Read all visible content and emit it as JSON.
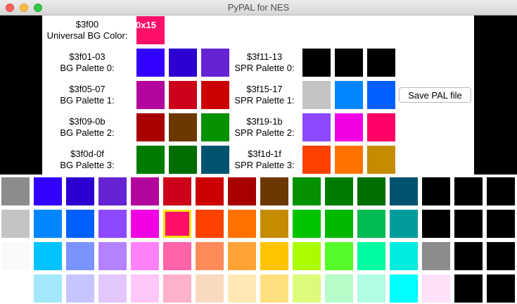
{
  "window": {
    "title": "PyPAL for NES"
  },
  "universal": {
    "address": "$3f00",
    "label": "Universal BG Color:",
    "hex": "0x15",
    "color": "#ff1068"
  },
  "bg_palettes": [
    {
      "address": "$3f01-03",
      "label": "BG Palette 0:",
      "colors": [
        "#3200ff",
        "#2b00d0",
        "#6523d3"
      ]
    },
    {
      "address": "$3f05-07",
      "label": "BG Palette 1:",
      "colors": [
        "#b3049e",
        "#cc0019",
        "#cb0000"
      ]
    },
    {
      "address": "$3f09-0b",
      "label": "BG Palette 2:",
      "colors": [
        "#a80000",
        "#6b3900",
        "#069100"
      ]
    },
    {
      "address": "$3f0d-0f",
      "label": "BG Palette 3:",
      "colors": [
        "#007d00",
        "#006d00",
        "#00536f"
      ]
    }
  ],
  "spr_palettes": [
    {
      "address": "$3f11-13",
      "label": "SPR Palette 0:",
      "colors": [
        "#000000",
        "#000000",
        "#000000"
      ]
    },
    {
      "address": "$3f15-17",
      "label": "SPR Palette 1:",
      "colors": [
        "#c4c4c4",
        "#0087ff",
        "#0060ff"
      ]
    },
    {
      "address": "$3f19-1b",
      "label": "SPR Palette 2:",
      "colors": [
        "#8c49ff",
        "#f100e4",
        "#ff0066"
      ]
    },
    {
      "address": "$3f1d-1f",
      "label": "SPR Palette 3:",
      "colors": [
        "#ff4100",
        "#ff7200",
        "#c68c00"
      ]
    }
  ],
  "save_button": {
    "label": "Save PAL file"
  },
  "grid": {
    "selected_row": 1,
    "selected_col": 5,
    "rows": [
      [
        "#8c8c8c",
        "#3200ff",
        "#2b00d0",
        "#6523d3",
        "#b3049e",
        "#cc0019",
        "#cb0000",
        "#a80000",
        "#6b3900",
        "#069100",
        "#007d00",
        "#006d00",
        "#00536f",
        "#000000",
        "#000000",
        "#000000"
      ],
      [
        "#c4c4c4",
        "#0087ff",
        "#0060ff",
        "#8c49ff",
        "#f100e4",
        "#ff1068",
        "#ff4100",
        "#ff7200",
        "#c68c00",
        "#00c400",
        "#00b800",
        "#00bc52",
        "#009c9c",
        "#000000",
        "#000000",
        "#000000"
      ],
      [
        "#fafafa",
        "#00c3ff",
        "#7b93ff",
        "#b482ff",
        "#ff81f8",
        "#ff63a8",
        "#ff8b5b",
        "#ffa336",
        "#ffc400",
        "#acfc00",
        "#55fa28",
        "#00fa9f",
        "#00ece0",
        "#8c8c8c",
        "#000000",
        "#000000"
      ],
      [
        "#ffffff",
        "#a3e8fb",
        "#c7c5ff",
        "#e2c7fc",
        "#ffc6f8",
        "#ffb0cb",
        "#f9dabf",
        "#ffe8b3",
        "#ffe07e",
        "#dcfb7b",
        "#b6fbc8",
        "#b1fde4",
        "#00ffff",
        "#ffe0f9",
        "#000000",
        "#000000"
      ]
    ]
  }
}
